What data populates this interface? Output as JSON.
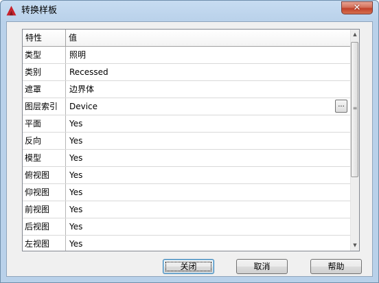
{
  "window": {
    "title": "转换样板",
    "close_glyph": "✕",
    "icon": "autocad-logo-icon",
    "accent": "#c8202a"
  },
  "grid": {
    "columns": [
      "特性",
      "值"
    ],
    "rows": [
      {
        "property": "类型",
        "value": "照明"
      },
      {
        "property": "类别",
        "value": "Recessed"
      },
      {
        "property": "遮罩",
        "value": "边界体"
      },
      {
        "property": "图层索引",
        "value": "Device",
        "has_browse": true,
        "browse_label": "..."
      },
      {
        "property": "平面",
        "value": "Yes"
      },
      {
        "property": "反向",
        "value": "Yes"
      },
      {
        "property": "模型",
        "value": "Yes"
      },
      {
        "property": "俯视图",
        "value": "Yes"
      },
      {
        "property": "仰视图",
        "value": "Yes"
      },
      {
        "property": "前视图",
        "value": "Yes"
      },
      {
        "property": "后视图",
        "value": "Yes"
      },
      {
        "property": "左视图",
        "value": "Yes"
      }
    ],
    "scroll": {
      "up_glyph": "▲",
      "down_glyph": "▼",
      "grip": "≡"
    }
  },
  "buttons": {
    "close_label": "关闭",
    "cancel_label": "取消",
    "help_label": "帮助"
  }
}
